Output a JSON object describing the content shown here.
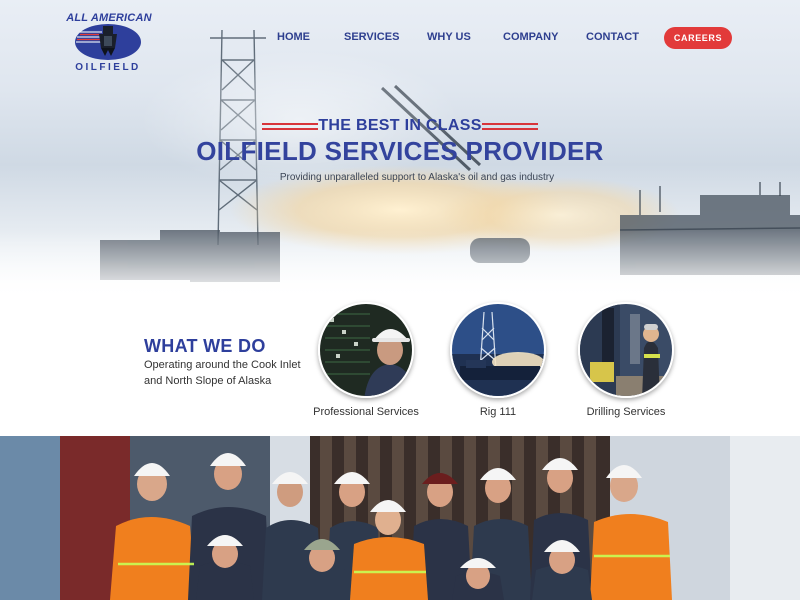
{
  "brand": {
    "logo_top": "ALL AMERICAN",
    "logo_bottom": "OILFIELD",
    "primary_color": "#2e3f9c",
    "accent_color": "#e23a3a"
  },
  "nav": {
    "items": [
      {
        "label": "HOME"
      },
      {
        "label": "SERVICES"
      },
      {
        "label": "WHY US"
      },
      {
        "label": "COMPANY"
      },
      {
        "label": "CONTACT"
      }
    ],
    "cta_label": "CAREERS"
  },
  "hero": {
    "kicker": "THE BEST IN CLASS",
    "headline": "OILFIELD SERVICES PROVIDER",
    "tagline": "Providing unparalleled support to Alaska's oil and gas industry"
  },
  "what_we_do": {
    "title": "WHAT WE DO",
    "description": "Operating around the Cook Inlet and North Slope of Alaska",
    "services": [
      {
        "label": "Professional Services",
        "icon": "technician-photo"
      },
      {
        "label": "Rig 111",
        "icon": "drilling-rig-photo"
      },
      {
        "label": "Drilling Services",
        "icon": "drill-floor-photo"
      }
    ]
  }
}
